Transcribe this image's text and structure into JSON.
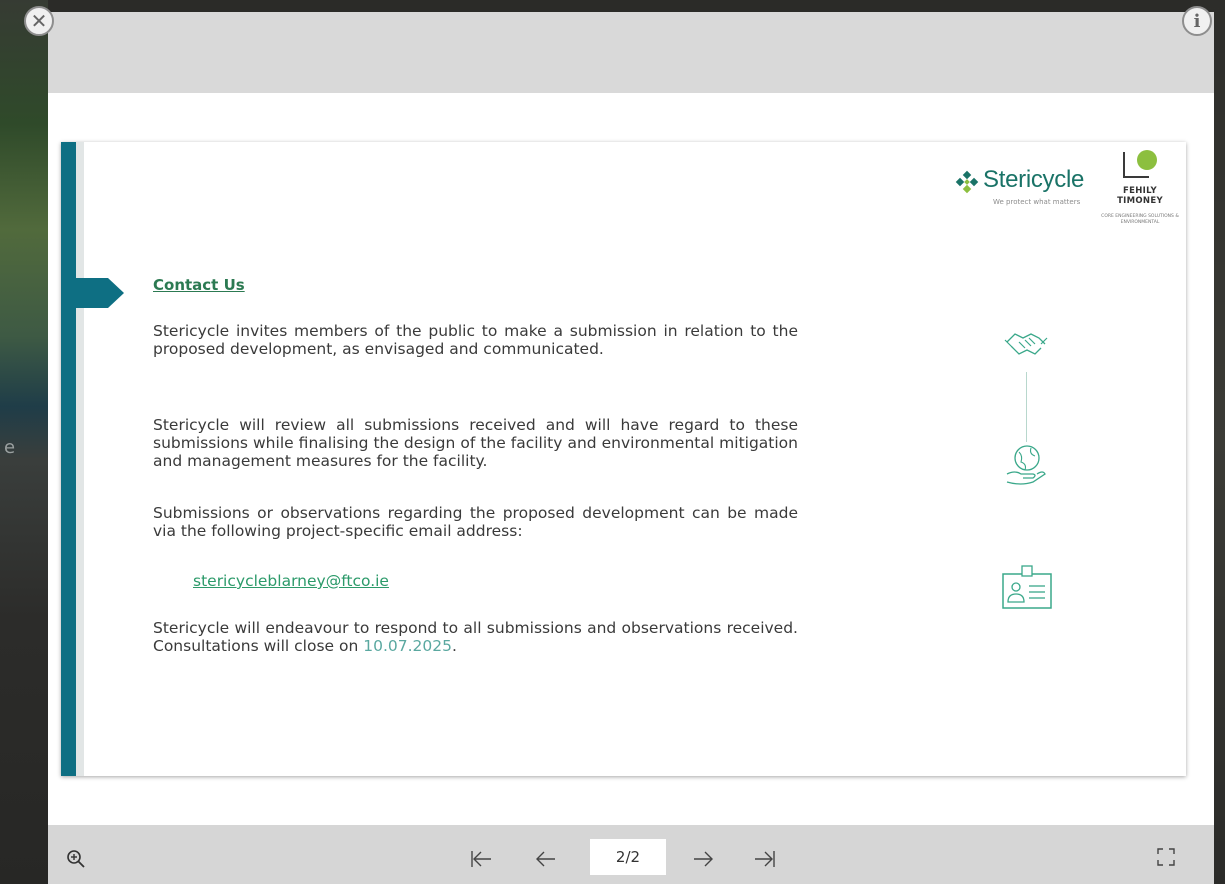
{
  "background": {
    "peek_text": "e"
  },
  "lightbox": {
    "close_glyph": "✕",
    "info_glyph": "i"
  },
  "slide": {
    "heading": "Contact Us",
    "para_1": "Stericycle invites members of the public to make a submission in relation to the proposed development, as envisaged and communicated.",
    "para_2": "Stericycle will review all submissions received and will have regard to these submissions while finalising the design of the facility and environmental mitigation and management measures for the facility.",
    "para_3": "Submissions or observations regarding the proposed development can be made via the following project-specific email address:",
    "email": "stericycleblarney@ftco.ie",
    "para_4_prefix": "Stericycle will endeavour to respond to all submissions and observations received. Consultations will close on ",
    "close_date": "10.07.2025",
    "para_4_suffix": ".",
    "logos": {
      "stericycle_name": "Stericycle",
      "stericycle_tagline": "We protect what matters",
      "ft_line_1": "FEHILY",
      "ft_line_2": "TIMONEY",
      "ft_sub": "CORE ENGINEERING SOLUTIONS & ENVIRONMENTAL"
    },
    "icons": [
      "handshake-icon",
      "globe-hand-icon",
      "id-card-icon"
    ],
    "colors": {
      "accent_bar": "#0e6f83",
      "heading": "#2c7a52",
      "link": "#2c9a6a",
      "icon": "#3aa88a"
    }
  },
  "footer": {
    "zoom_glyph": "⊕",
    "first_glyph": "⇤",
    "prev_glyph": "←",
    "page_indicator": "2/2",
    "next_glyph": "→",
    "last_glyph": "⇥"
  }
}
